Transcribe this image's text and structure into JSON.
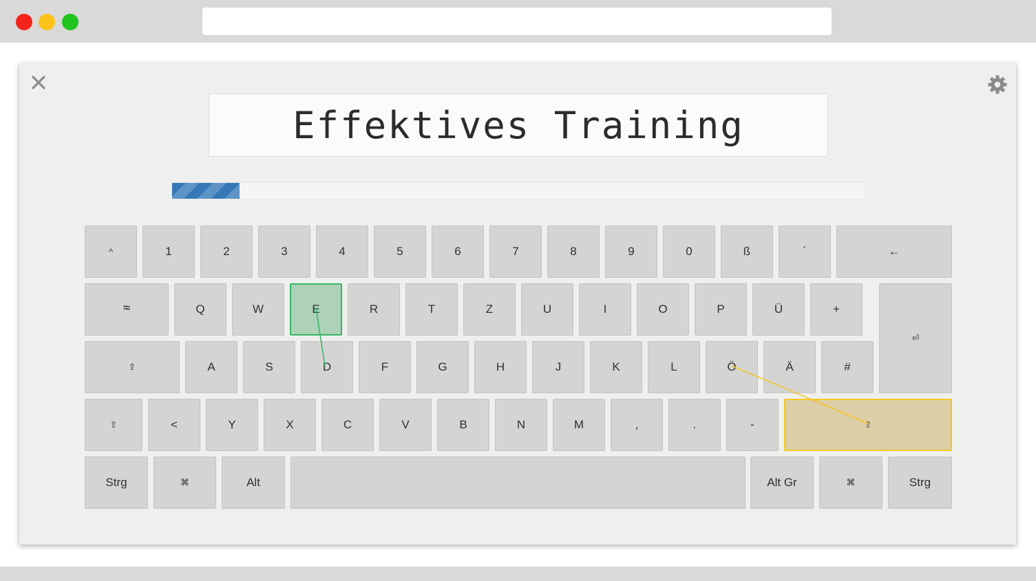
{
  "window": {
    "controls": [
      "close",
      "minimize",
      "maximize"
    ]
  },
  "toolbar": {
    "close_icon": "close-icon",
    "settings_icon": "gear-icon"
  },
  "lesson": {
    "title": "Effektives Training",
    "progress": 0.097
  },
  "colors": {
    "progress": "#3578b6",
    "target_key": "#35b565",
    "shift_key": "#f3c623",
    "key_bg": "#d4d5d3"
  },
  "keyboard": {
    "row1": [
      "^",
      "1",
      "2",
      "3",
      "4",
      "5",
      "6",
      "7",
      "8",
      "9",
      "0",
      "ß",
      "´",
      "←"
    ],
    "row2": [
      "⭾",
      "Q",
      "W",
      "E",
      "R",
      "T",
      "Z",
      "U",
      "I",
      "O",
      "P",
      "Ü",
      "+"
    ],
    "enter": "⏎",
    "row3": [
      "⇪",
      "A",
      "S",
      "D",
      "F",
      "G",
      "H",
      "J",
      "K",
      "L",
      "Ö",
      "Ä",
      "#"
    ],
    "row4": [
      "⇧",
      "<",
      "Y",
      "X",
      "C",
      "V",
      "B",
      "N",
      "M",
      ",",
      ".",
      "-",
      "⇧"
    ],
    "row5": [
      "Strg",
      "⌘",
      "Alt",
      "",
      "Alt Gr",
      "⌘",
      "Strg"
    ],
    "highlight": {
      "next_key": "E",
      "modifier": "right-shift"
    }
  }
}
